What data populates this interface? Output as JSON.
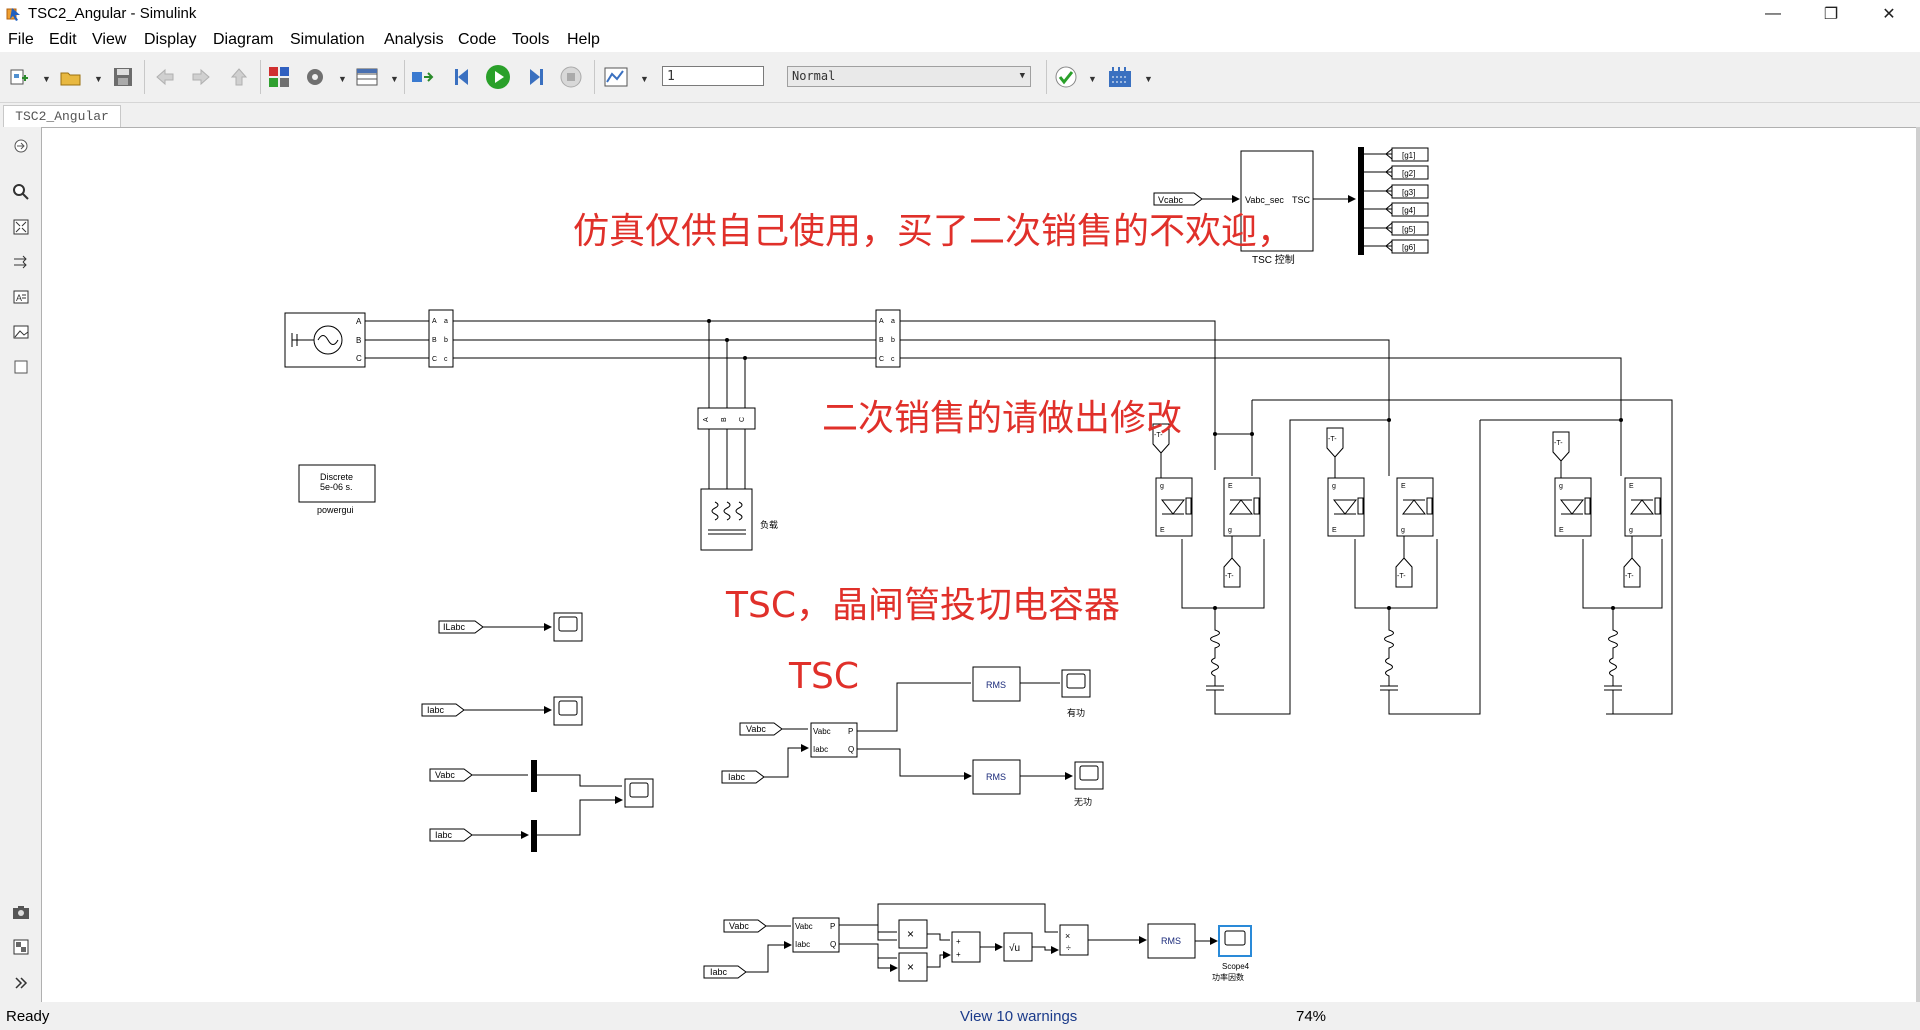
{
  "window": {
    "title": "TSC2_Angular - Simulink",
    "minimize": "—",
    "restore": "❐",
    "close": "✕"
  },
  "menu": [
    "File",
    "Edit",
    "View",
    "Display",
    "Diagram",
    "Simulation",
    "Analysis",
    "Code",
    "Tools",
    "Help"
  ],
  "toolbar": {
    "stop_time": "1",
    "sim_mode": "Normal",
    "icons": [
      "new-model-icon",
      "open-icon",
      "save-icon",
      "back-icon",
      "forward-icon",
      "up-icon",
      "library-browser-icon",
      "model-config-icon",
      "model-explorer-icon",
      "update-diagram-icon",
      "step-back-icon",
      "run-icon",
      "step-forward-icon",
      "stop-icon",
      "data-inspector-icon",
      "model-advisor-icon",
      "build-icon"
    ]
  },
  "tab": {
    "label": "TSC2_Angular"
  },
  "status": {
    "ready": "Ready",
    "warnings": "View 10 warnings",
    "zoom": "74%"
  },
  "diagram": {
    "overlay_texts": [
      "仿真仅供自己使用，买了二次销售的不欢迎，",
      "二次销售的请做出修改",
      "TSC，晶闸管投切电容器",
      "TSC"
    ],
    "tsc_control": {
      "in_port": "Vabc_sec",
      "out_port": "TSC",
      "label": "TSC 控制",
      "input_tag": "Vcabc",
      "goto_tags": [
        "[g1]",
        "[g2]",
        "[g3]",
        "[g4]",
        "[g5]",
        "[g6]"
      ]
    },
    "powergui": {
      "line1": "Discrete",
      "line2": "5e-06 s.",
      "label": "powergui"
    },
    "load_label": "负载",
    "port_letters": {
      "A": "A",
      "B": "B",
      "C": "C",
      "a": "a",
      "b": "b",
      "c": "c",
      "g": "g",
      "k": "k",
      "E": "E",
      "T": "-T-"
    },
    "from_tags": {
      "ilabc": "ILabc",
      "iabc": "Iabc",
      "vabc": "Vabc"
    },
    "power_block": {
      "vabc": "Vabc",
      "iabc": "Iabc",
      "p": "P",
      "q": "Q"
    },
    "rms": "RMS",
    "active_label": "有功",
    "reactive_label": "无功",
    "scope4": {
      "name": "Scope4",
      "label": "功率因数"
    },
    "math": {
      "times": "×",
      "plus": "+",
      "sqrt": "√u"
    }
  }
}
